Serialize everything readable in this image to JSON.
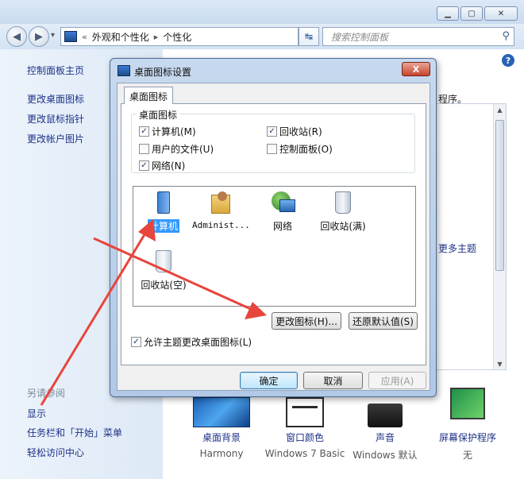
{
  "window": {
    "minimize_glyph": "▁",
    "maximize_glyph": "▢",
    "close_glyph": "✕"
  },
  "nav": {
    "back_glyph": "◀",
    "forward_glyph": "▶",
    "dropdown_glyph": "▾",
    "breadcrumb_prefix": "«",
    "breadcrumb": [
      "外观和个性化",
      "个性化"
    ],
    "breadcrumb_sep": "▸",
    "refresh_glyph": "↹",
    "search_placeholder": "搜索控制面板"
  },
  "left_pane": {
    "links": [
      "控制面板主页",
      "更改桌面图标",
      "更改鼠标指针",
      "更改帐户图片"
    ],
    "see_also_label": "另请参阅",
    "see_also_links": [
      "显示",
      "任务栏和「开始」菜单",
      "轻松访问中心"
    ]
  },
  "content": {
    "help_glyph": "?",
    "fragment_text": "程序。",
    "more_themes_link": "更多主题",
    "bottom_items": [
      {
        "label": "桌面背景",
        "sub": "Harmony"
      },
      {
        "label": "窗口颜色",
        "sub": "Windows 7 Basic"
      },
      {
        "label": "声音",
        "sub": "Windows 默认"
      },
      {
        "label": "屏幕保护程序",
        "sub": "无"
      }
    ]
  },
  "dialog": {
    "title": "桌面图标设置",
    "close_glyph": "X",
    "tab": "桌面图标",
    "group_label": "桌面图标",
    "checkboxes": [
      {
        "label": "计算机(M)",
        "checked": true
      },
      {
        "label": "回收站(R)",
        "checked": true
      },
      {
        "label": "用户的文件(U)",
        "checked": false
      },
      {
        "label": "控制面板(O)",
        "checked": false
      },
      {
        "label": "网络(N)",
        "checked": true
      }
    ],
    "check_glyph": "✓",
    "icons": [
      {
        "label": "计算机",
        "selected": true
      },
      {
        "label": "Administ...",
        "selected": false
      },
      {
        "label": "网络",
        "selected": false
      },
      {
        "label": "回收站(满)",
        "selected": false
      },
      {
        "label": "回收站(空)",
        "selected": false
      }
    ],
    "change_icon_button": "更改图标(H)...",
    "restore_default_button": "还原默认值(S)",
    "allow_themes_checkbox": {
      "label": "允许主题更改桌面图标(L)",
      "checked": true
    },
    "ok_button": "确定",
    "cancel_button": "取消",
    "apply_button": "应用(A)"
  },
  "colors": {
    "link": "#1e3287",
    "selection": "#3399ff",
    "annotation_arrow": "#e8453c"
  }
}
